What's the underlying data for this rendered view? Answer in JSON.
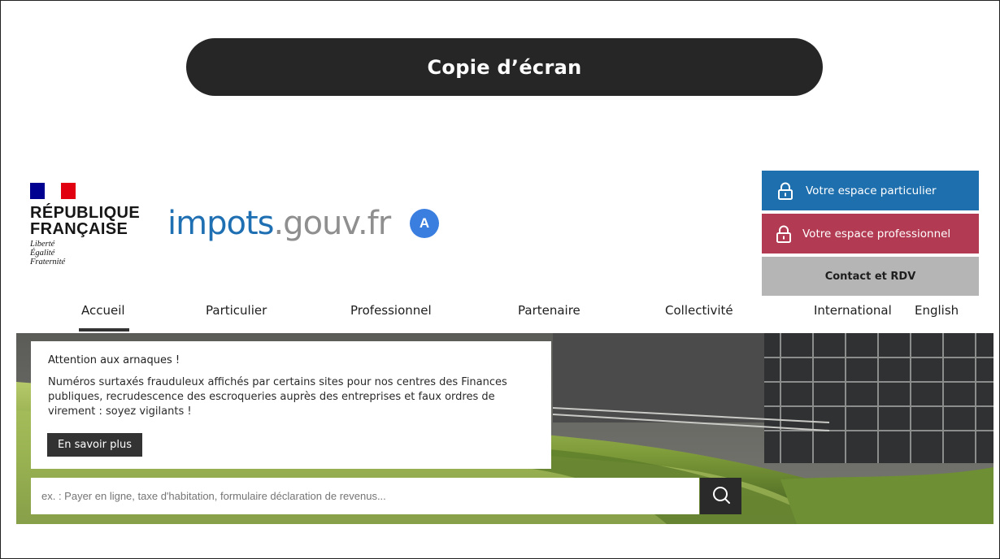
{
  "banner": {
    "title": "Copie d’écran"
  },
  "logo": {
    "line1": "RÉPUBLIQUE",
    "line2": "FRANÇAISE",
    "motto1": "Liberté",
    "motto2": "Égalité",
    "motto3": "Fraternité"
  },
  "brand": {
    "part1": "impots",
    "part2": ".gouv.fr",
    "badge": "A"
  },
  "buttons": {
    "particulier": "Votre espace particulier",
    "professionnel": "Votre espace professionnel",
    "contact": "Contact et RDV"
  },
  "nav": [
    "Accueil",
    "Particulier",
    "Professionnel",
    "Partenaire",
    "Collectivité",
    "International",
    "English"
  ],
  "alert": {
    "title": "Attention aux arnaques !",
    "body": "Numéros surtaxés frauduleux affichés par certains sites pour nos centres des Finances publiques, recrudescence des escroqueries auprès des entreprises et faux ordres de virement : soyez vigilants !",
    "button": "En savoir plus"
  },
  "search": {
    "placeholder": "ex. : Payer en ligne, taxe d'habitation, formulaire déclaration de revenus..."
  },
  "icons": {
    "lock": "lock-icon",
    "search": "search-icon"
  },
  "colors": {
    "particulier": "#1e6fae",
    "professionnel": "#b23a52",
    "contact": "#b5b5b5",
    "banner": "#262626"
  }
}
